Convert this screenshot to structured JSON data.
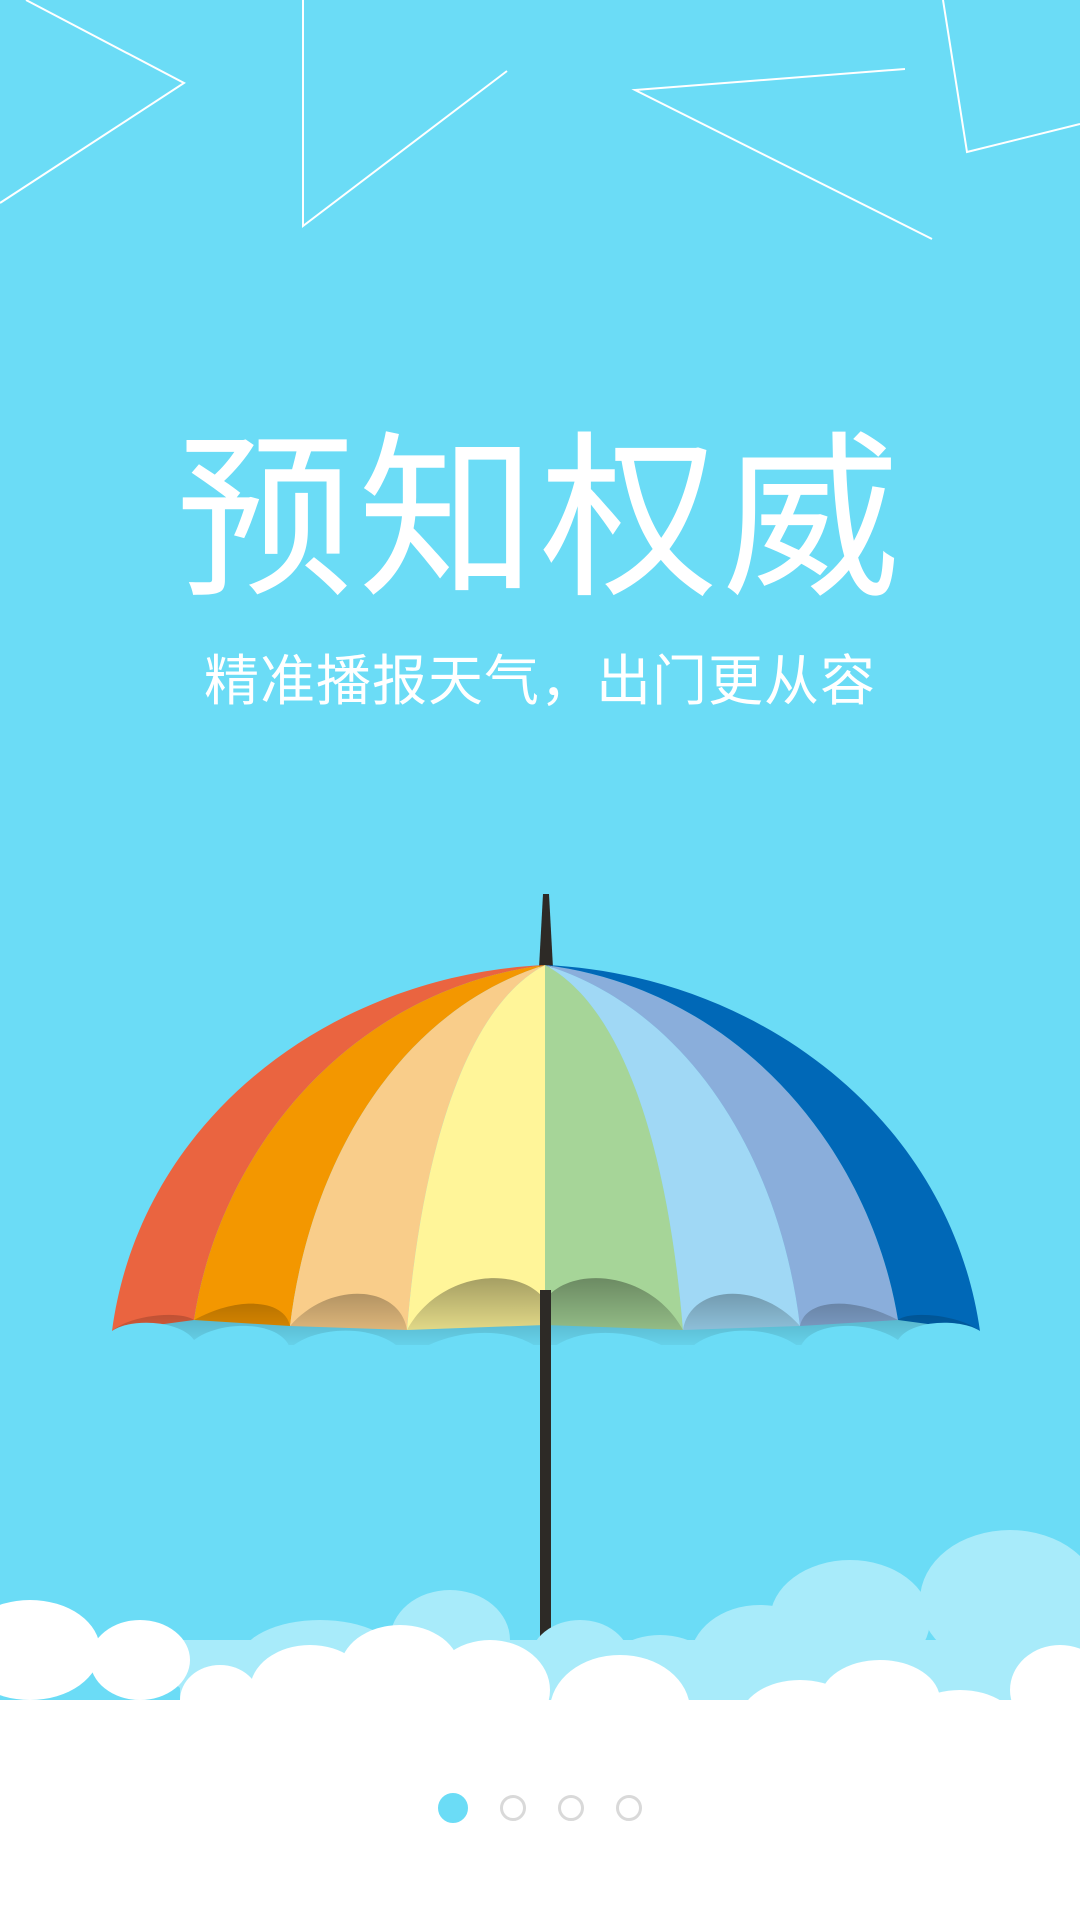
{
  "screen": {
    "title": "预知权威",
    "subtitle": "精准播报天气，出门更从容"
  },
  "colors": {
    "background": "#6bdcf6",
    "text": "#ffffff",
    "dot_active": "#6bdcf6",
    "dot_inactive_border": "#d9d9d9"
  },
  "illustration": {
    "icon": "rainbow-umbrella-illustration",
    "panel_colors": [
      "#ea6440",
      "#f39700",
      "#f9cd8a",
      "#fff599",
      "#a6d598",
      "#a0d8f5",
      "#8aaedb",
      "#0068b7"
    ]
  },
  "pager": {
    "count": 4,
    "active_index": 0
  }
}
